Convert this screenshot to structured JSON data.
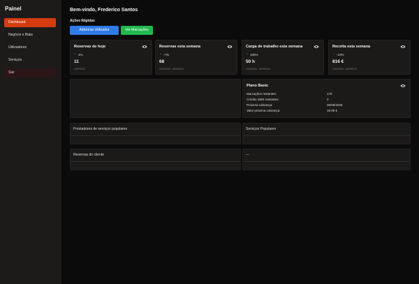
{
  "sidebar": {
    "title": "Painel",
    "items": [
      {
        "label": "Dashboard"
      },
      {
        "label": "Negócio e filiais"
      },
      {
        "label": "Utilizadores"
      },
      {
        "label": "Serviços"
      },
      {
        "label": "Sair"
      }
    ]
  },
  "header": {
    "welcome": "Bem-vindo, Frederico Santos"
  },
  "quick_actions": {
    "title": "Ações Rápidas",
    "add_user": "Adicionar Utilizador",
    "view_bookings": "Ver Marcações"
  },
  "stats": [
    {
      "title": "Reservas de hoje",
      "change": "4%",
      "trend": "up",
      "value": "11",
      "date": "29/09/2025"
    },
    {
      "title": "Reservas esta semana",
      "change": "-7%",
      "trend": "down",
      "value": "68",
      "date": "22/09/2025 - 28/09/2025"
    },
    {
      "title": "Carga de trabalho esta semana",
      "change": "100%",
      "trend": "up",
      "value": "50 h",
      "date": "22/09/2025 - 28/09/2025"
    },
    {
      "title": "Receita esta semana",
      "change": "-10%",
      "trend": "down",
      "value": "816 €",
      "date": "22/09/2025 - 28/09/2025"
    }
  ],
  "plan": {
    "title": "Plano Basic",
    "rows": [
      {
        "label": "Marcações restantes:",
        "value": "179"
      },
      {
        "label": "Crédito SMS restantes:",
        "value": "0"
      },
      {
        "label": "Próxima cobrança:",
        "value": "28/09/2026"
      },
      {
        "label": "Valor próxima cobrança:",
        "value": "19.99 €"
      }
    ]
  },
  "panels": {
    "popular_providers": "Prestadores de serviços populares",
    "popular_services": "Serviços Populares",
    "client_bookings": "Reservas do cliente",
    "other": "---"
  },
  "colors": {
    "accent": "#d43c10",
    "blue_button": "#2f7ce8",
    "green_button": "#22b94f",
    "trend_up": "#2ec05a",
    "trend_down": "#e35a3a"
  }
}
